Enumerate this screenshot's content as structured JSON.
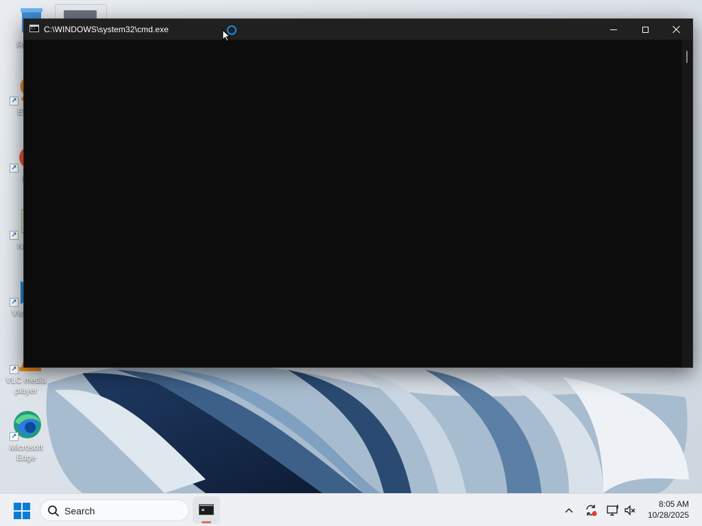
{
  "desktop": {
    "icons": [
      {
        "name": "recycle-bin",
        "label": "Recy"
      },
      {
        "name": "everything",
        "label": "Ever"
      },
      {
        "name": "firefox",
        "label": "Fi"
      },
      {
        "name": "notepad-plus-plus",
        "label": "Note"
      },
      {
        "name": "visual-studio-code",
        "label": "Visua C"
      },
      {
        "name": "vlc-media-player",
        "label": "VLC media player"
      },
      {
        "name": "microsoft-edge",
        "label": "Microsoft Edge"
      }
    ]
  },
  "window": {
    "title": "C:\\WINDOWS\\system32\\cmd.exe",
    "console_text": ""
  },
  "taskbar": {
    "search_placeholder": "Search",
    "clock": {
      "time": "8:05 AM",
      "date": "10/28/2025"
    }
  },
  "colors": {
    "console_bg": "#0c0c0c",
    "titlebar_bg": "#202020",
    "taskbar_bg": "#eef0f3",
    "start_blue": "#0a7cd6",
    "active_indicator": "#e06a54"
  }
}
